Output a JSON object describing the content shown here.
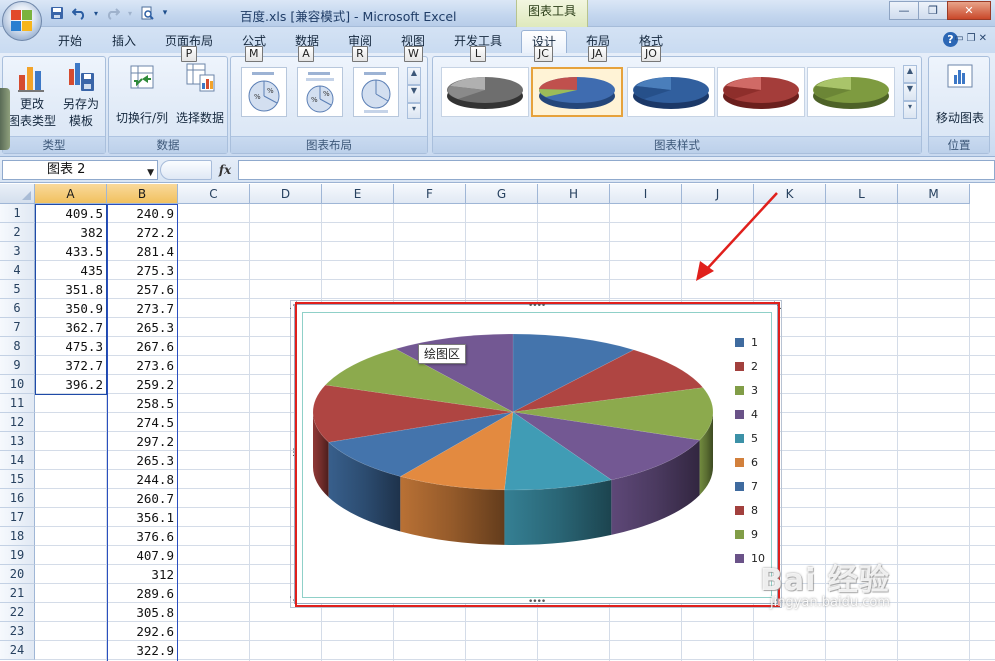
{
  "window": {
    "file_title": "百度.xls  [兼容模式] - Microsoft Excel",
    "context_tools": "图表工具"
  },
  "tabs": [
    {
      "label": "开始",
      "keytip": ""
    },
    {
      "label": "插入",
      "keytip": ""
    },
    {
      "label": "页面布局",
      "keytip": "P"
    },
    {
      "label": "公式",
      "keytip": "M"
    },
    {
      "label": "数据",
      "keytip": "A"
    },
    {
      "label": "审阅",
      "keytip": "R"
    },
    {
      "label": "视图",
      "keytip": "W"
    },
    {
      "label": "开发工具",
      "keytip": "L"
    },
    {
      "label": "设计",
      "keytip": "JC"
    },
    {
      "label": "布局",
      "keytip": "JA"
    },
    {
      "label": "格式",
      "keytip": "JO"
    }
  ],
  "ribbon": {
    "groups": {
      "type": "类型",
      "data": "数据",
      "layout": "图表布局",
      "styles": "图表样式",
      "location": "位置"
    },
    "buttons": {
      "change_type_l1": "更改",
      "change_type_l2": "图表类型",
      "save_template_l1": "另存为",
      "save_template_l2": "模板",
      "switch_row_col": "切换行/列",
      "select_data": "选择数据",
      "move_chart": "移动图表"
    }
  },
  "formula_bar": {
    "name_box": "图表 2",
    "fx": "fx",
    "content": ""
  },
  "columns": [
    "A",
    "B",
    "C",
    "D",
    "E",
    "F",
    "G",
    "H",
    "I",
    "J",
    "K",
    "L",
    "M"
  ],
  "rows": [
    "1",
    "2",
    "3",
    "4",
    "5",
    "6",
    "7",
    "8",
    "9",
    "10",
    "11",
    "12",
    "13",
    "14",
    "15",
    "16",
    "17",
    "18",
    "19",
    "20",
    "21",
    "22",
    "23",
    "24"
  ],
  "col_a": [
    "409.5",
    "382",
    "433.5",
    "435",
    "351.8",
    "350.9",
    "362.7",
    "475.3",
    "372.7",
    "396.2"
  ],
  "col_b": [
    "240.9",
    "272.2",
    "281.4",
    "275.3",
    "257.6",
    "273.7",
    "265.3",
    "267.6",
    "273.6",
    "259.2",
    "258.5",
    "274.5",
    "297.2",
    "265.3",
    "244.8",
    "260.7",
    "356.1",
    "376.6",
    "407.9",
    "312",
    "289.6",
    "305.8",
    "292.6",
    "322.9"
  ],
  "chart_tooltip": "绘图区",
  "chart_data": {
    "type": "pie",
    "title": "",
    "categories": [
      "1",
      "2",
      "3",
      "4",
      "5",
      "6",
      "7",
      "8",
      "9",
      "10"
    ],
    "values": [
      409.5,
      382,
      433.5,
      435,
      351.8,
      350.9,
      362.7,
      475.3,
      372.7,
      396.2
    ],
    "colors": [
      "#4a7ebb",
      "#be4b48",
      "#98b954",
      "#7d60a0",
      "#46aac5",
      "#f79646",
      "#4a7ebb",
      "#be4b48",
      "#98b954",
      "#7d60a0"
    ],
    "legend_position": "right",
    "three_d": true
  },
  "watermark": {
    "brand": "Bai 经验",
    "url": "jingyan.baidu.com"
  }
}
